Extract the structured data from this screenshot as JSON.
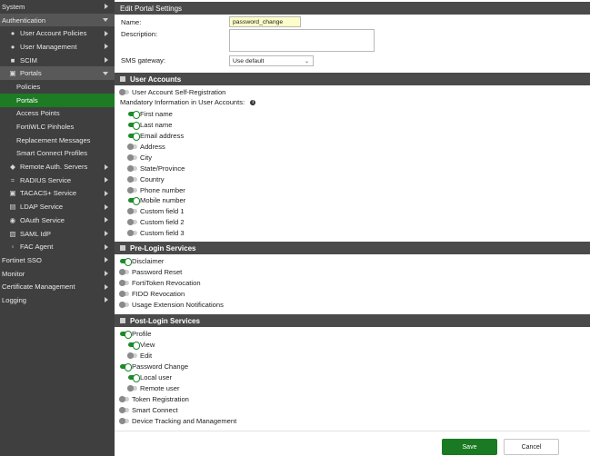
{
  "sidebar": {
    "system": "System",
    "authentication": "Authentication",
    "user_account_policies": "User Account Policies",
    "user_management": "User Management",
    "scim": "SCIM",
    "portals": "Portals",
    "portals_sub": [
      "Policies",
      "Portals",
      "Access Points",
      "FortiWLC Pinholes",
      "Replacement Messages",
      "Smart Connect Profiles"
    ],
    "remote_auth": "Remote Auth. Servers",
    "radius": "RADIUS Service",
    "tacacs": "TACACS+ Service",
    "ldap": "LDAP Service",
    "oauth": "OAuth Service",
    "saml": "SAML IdP",
    "fac_agent": "FAC Agent",
    "fortinet_sso": "Fortinet SSO",
    "monitor": "Monitor",
    "cert_mgmt": "Certificate Management",
    "logging": "Logging"
  },
  "main": {
    "title": "Edit Portal Settings",
    "name_label": "Name:",
    "name_value": "password_change",
    "description_label": "Description:",
    "description_value": "",
    "sms_label": "SMS gateway:",
    "sms_value": "Use default",
    "user_accounts": {
      "header": "User Accounts",
      "self_reg": "User Account Self-Registration",
      "mandatory_label": "Mandatory Information in User Accounts:",
      "fields": [
        {
          "label": "First name",
          "on": true
        },
        {
          "label": "Last name",
          "on": true
        },
        {
          "label": "Email address",
          "on": true
        },
        {
          "label": "Address",
          "on": false
        },
        {
          "label": "City",
          "on": false
        },
        {
          "label": "State/Province",
          "on": false
        },
        {
          "label": "Country",
          "on": false
        },
        {
          "label": "Phone number",
          "on": false
        },
        {
          "label": "Mobile number",
          "on": true
        },
        {
          "label": "Custom field 1",
          "on": false
        },
        {
          "label": "Custom field 2",
          "on": false
        },
        {
          "label": "Custom field 3",
          "on": false
        }
      ]
    },
    "pre_login": {
      "header": "Pre-Login Services",
      "items": [
        {
          "label": "Disclaimer",
          "on": true
        },
        {
          "label": "Password Reset",
          "on": false
        },
        {
          "label": "FortiToken Revocation",
          "on": false
        },
        {
          "label": "FIDO Revocation",
          "on": false
        },
        {
          "label": "Usage Extension Notifications",
          "on": false
        }
      ]
    },
    "post_login": {
      "header": "Post-Login Services",
      "profile": "Profile",
      "view": "View",
      "edit": "Edit",
      "password_change": "Password Change",
      "local_user": "Local user",
      "remote_user": "Remote user",
      "token_reg": "Token Registration",
      "smart_connect": "Smart Connect",
      "device_tracking": "Device Tracking and Management"
    },
    "save": "Save",
    "cancel": "Cancel"
  },
  "colors": {
    "accent_green": "#1d7b24",
    "sidebar_bg": "#3f3f3f",
    "header_bg": "#4a4a4a"
  }
}
